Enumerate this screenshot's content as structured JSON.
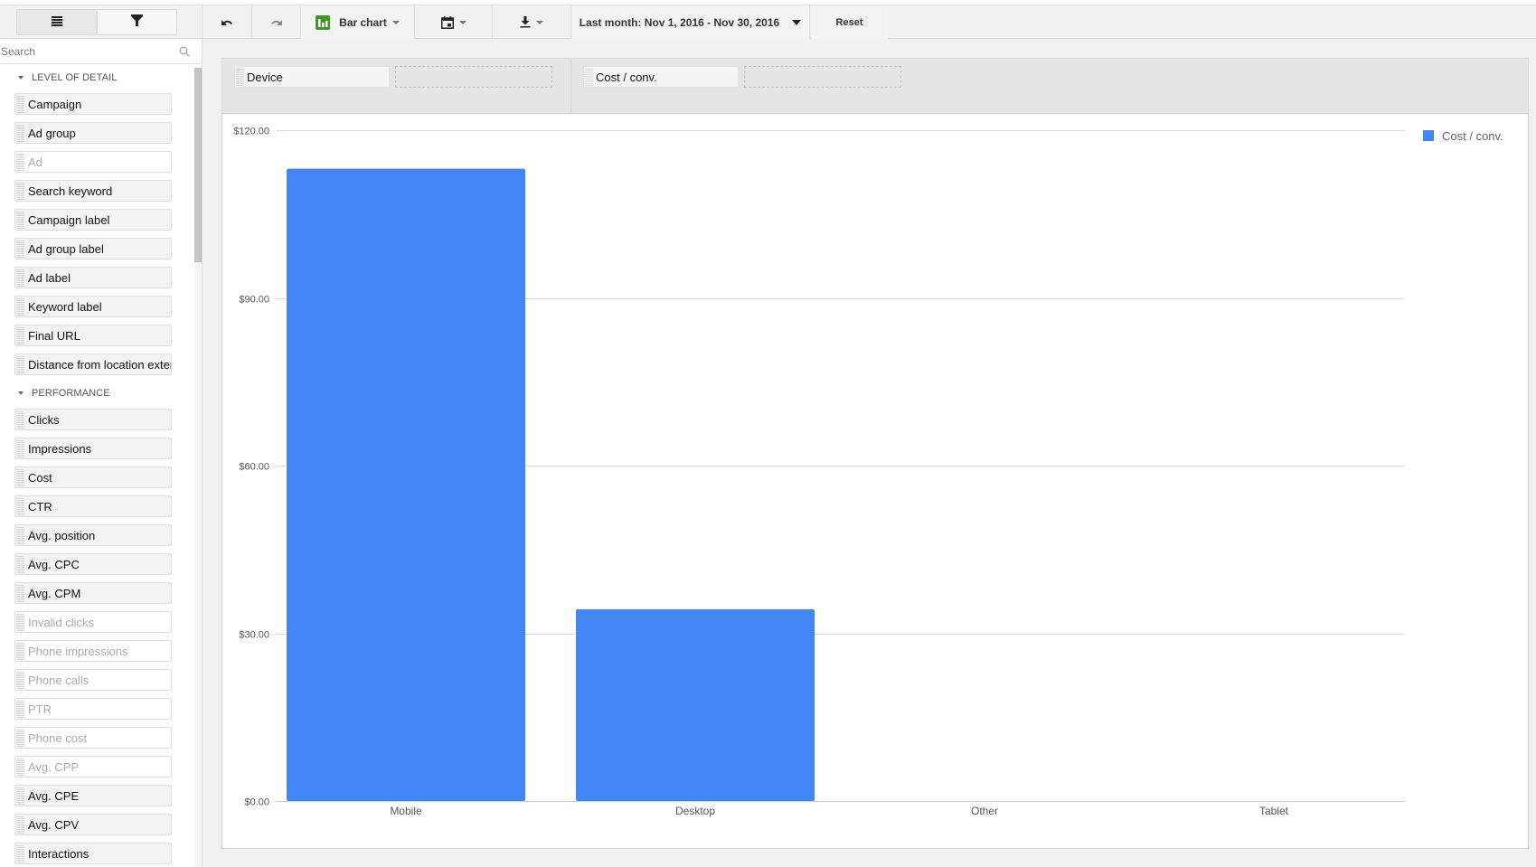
{
  "toolbar": {
    "list_view_icon": "list-icon",
    "filter_icon": "filter-icon",
    "undo_icon": "undo-icon",
    "redo_icon": "redo-icon",
    "chart_type_label": "Bar chart",
    "chart_type_icon": "bar-chart-icon",
    "calendar_icon": "calendar-icon",
    "download_icon": "download-icon",
    "date_range_label": "Last month: Nov 1, 2016 - Nov 30, 2016",
    "reset_label": "Reset"
  },
  "colors": {
    "bar": "#4285f4",
    "chart_icon_green": "#3a9a1e"
  },
  "sidebar": {
    "search_placeholder": "Search",
    "sections": [
      {
        "title": "LEVEL OF DETAIL",
        "items": [
          {
            "label": "Campaign",
            "enabled": true
          },
          {
            "label": "Ad group",
            "enabled": true
          },
          {
            "label": "Ad",
            "enabled": false
          },
          {
            "label": "Search keyword",
            "enabled": true
          },
          {
            "label": "Campaign label",
            "enabled": true
          },
          {
            "label": "Ad group label",
            "enabled": true
          },
          {
            "label": "Ad label",
            "enabled": true
          },
          {
            "label": "Keyword label",
            "enabled": true
          },
          {
            "label": "Final URL",
            "enabled": true
          },
          {
            "label": "Distance from location extension",
            "enabled": true
          }
        ]
      },
      {
        "title": "PERFORMANCE",
        "items": [
          {
            "label": "Clicks",
            "enabled": true
          },
          {
            "label": "Impressions",
            "enabled": true
          },
          {
            "label": "Cost",
            "enabled": true
          },
          {
            "label": "CTR",
            "enabled": true
          },
          {
            "label": "Avg. position",
            "enabled": true
          },
          {
            "label": "Avg. CPC",
            "enabled": true
          },
          {
            "label": "Avg. CPM",
            "enabled": true
          },
          {
            "label": "Invalid clicks",
            "enabled": false
          },
          {
            "label": "Phone impressions",
            "enabled": false
          },
          {
            "label": "Phone calls",
            "enabled": false
          },
          {
            "label": "PTR",
            "enabled": false
          },
          {
            "label": "Phone cost",
            "enabled": false
          },
          {
            "label": "Avg. CPP",
            "enabled": false
          },
          {
            "label": "Avg. CPE",
            "enabled": true
          },
          {
            "label": "Avg. CPV",
            "enabled": true
          },
          {
            "label": "Interactions",
            "enabled": true
          }
        ]
      }
    ]
  },
  "dropzones": {
    "dimension_chip": "Device",
    "metric_chip": "Cost / conv."
  },
  "chart_data": {
    "type": "bar",
    "title": "",
    "xlabel": "Device",
    "ylabel": "Cost / conv.",
    "categories": [
      "Mobile",
      "Desktop",
      "Other",
      "Tablet"
    ],
    "series": [
      {
        "name": "Cost / conv.",
        "values": [
          113.1,
          34.3,
          0,
          0
        ]
      }
    ],
    "ylim": [
      0,
      120
    ],
    "yticks": [
      0,
      30,
      60,
      90,
      120
    ],
    "ytick_labels": [
      "$0.00",
      "$30.00",
      "$60.00",
      "$90.00",
      "$120.00"
    ],
    "grid": true,
    "legend_position": "top-right"
  }
}
